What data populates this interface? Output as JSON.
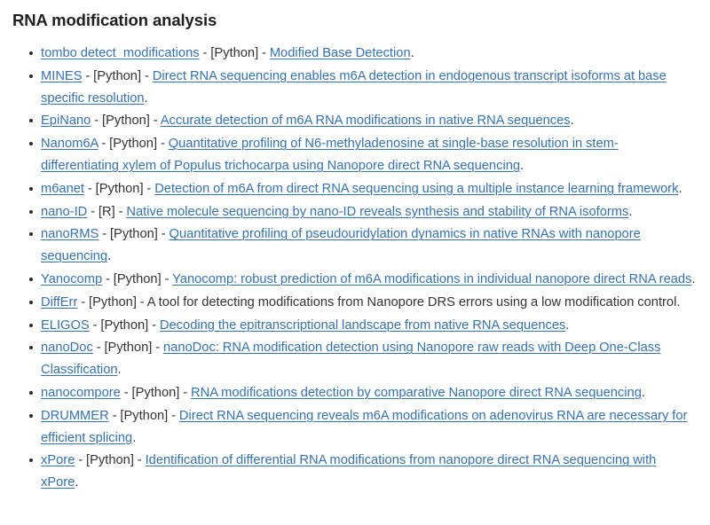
{
  "page": {
    "title": "RNA modification analysis",
    "separator": " - ",
    "period": ".",
    "link_color": "#3572b0",
    "text_color": "#333333",
    "title_color": "#1f1f1f",
    "background_color": "#ffffff"
  },
  "items": [
    {
      "name": "tombo detect_modifications",
      "name_is_link": true,
      "language": "[Python]",
      "description": "Modified Base Detection",
      "description_is_link": true
    },
    {
      "name": "MINES",
      "name_is_link": true,
      "language": "[Python]",
      "description": "Direct RNA sequencing enables m6A detection in endogenous transcript isoforms at base specific resolution",
      "description_is_link": true
    },
    {
      "name": "EpiNano",
      "name_is_link": true,
      "language": "[Python]",
      "description": "Accurate detection of m6A RNA modifications in native RNA sequences",
      "description_is_link": true
    },
    {
      "name": "Nanom6A",
      "name_is_link": true,
      "language": "[Python]",
      "description": "Quantitative profiling of N6-methyladenosine at single-base resolution in stem-differentiating xylem of Populus trichocarpa using Nanopore direct RNA sequencing",
      "description_is_link": true
    },
    {
      "name": "m6anet",
      "name_is_link": true,
      "language": "[Python]",
      "description": "Detection of m6A from direct RNA sequencing using a multiple instance learning framework",
      "description_is_link": true
    },
    {
      "name": "nano-ID",
      "name_is_link": true,
      "language": "[R]",
      "description": "Native molecule sequencing by nano-ID reveals synthesis and stability of RNA isoforms",
      "description_is_link": true
    },
    {
      "name": "nanoRMS",
      "name_is_link": true,
      "language": "[Python]",
      "description": "Quantitative profiling of pseudouridylation dynamics in native RNAs with nanopore sequencing",
      "description_is_link": true
    },
    {
      "name": "Yanocomp",
      "name_is_link": true,
      "language": "[Python]",
      "description": "Yanocomp: robust prediction of m6A modifications in individual nanopore direct RNA reads",
      "description_is_link": true
    },
    {
      "name": "DiffErr",
      "name_is_link": true,
      "language": "[Python]",
      "description": "A tool for detecting modifications from Nanopore DRS errors using a low modification control",
      "description_is_link": false
    },
    {
      "name": "ELIGOS",
      "name_is_link": true,
      "language": "[Python]",
      "description": "Decoding the epitranscriptional landscape from native RNA sequences",
      "description_is_link": true
    },
    {
      "name": "nanoDoc",
      "name_is_link": true,
      "language": "[Python]",
      "description": "nanoDoc: RNA modification detection using Nanopore raw reads with Deep One-Class Classification",
      "description_is_link": true
    },
    {
      "name": "nanocompore",
      "name_is_link": true,
      "language": "[Python]",
      "description": "RNA modifications detection by comparative Nanopore direct RNA sequencing",
      "description_is_link": true
    },
    {
      "name": "DRUMMER",
      "name_is_link": true,
      "language": "[Python]",
      "description": "Direct RNA sequencing reveals m6A modifications on adenovirus RNA are necessary for efficient splicing",
      "description_is_link": true
    },
    {
      "name": "xPore",
      "name_is_link": true,
      "language": "[Python]",
      "description": "Identification of differential RNA modifications from nanopore direct RNA sequencing with xPore",
      "description_is_link": true
    }
  ]
}
